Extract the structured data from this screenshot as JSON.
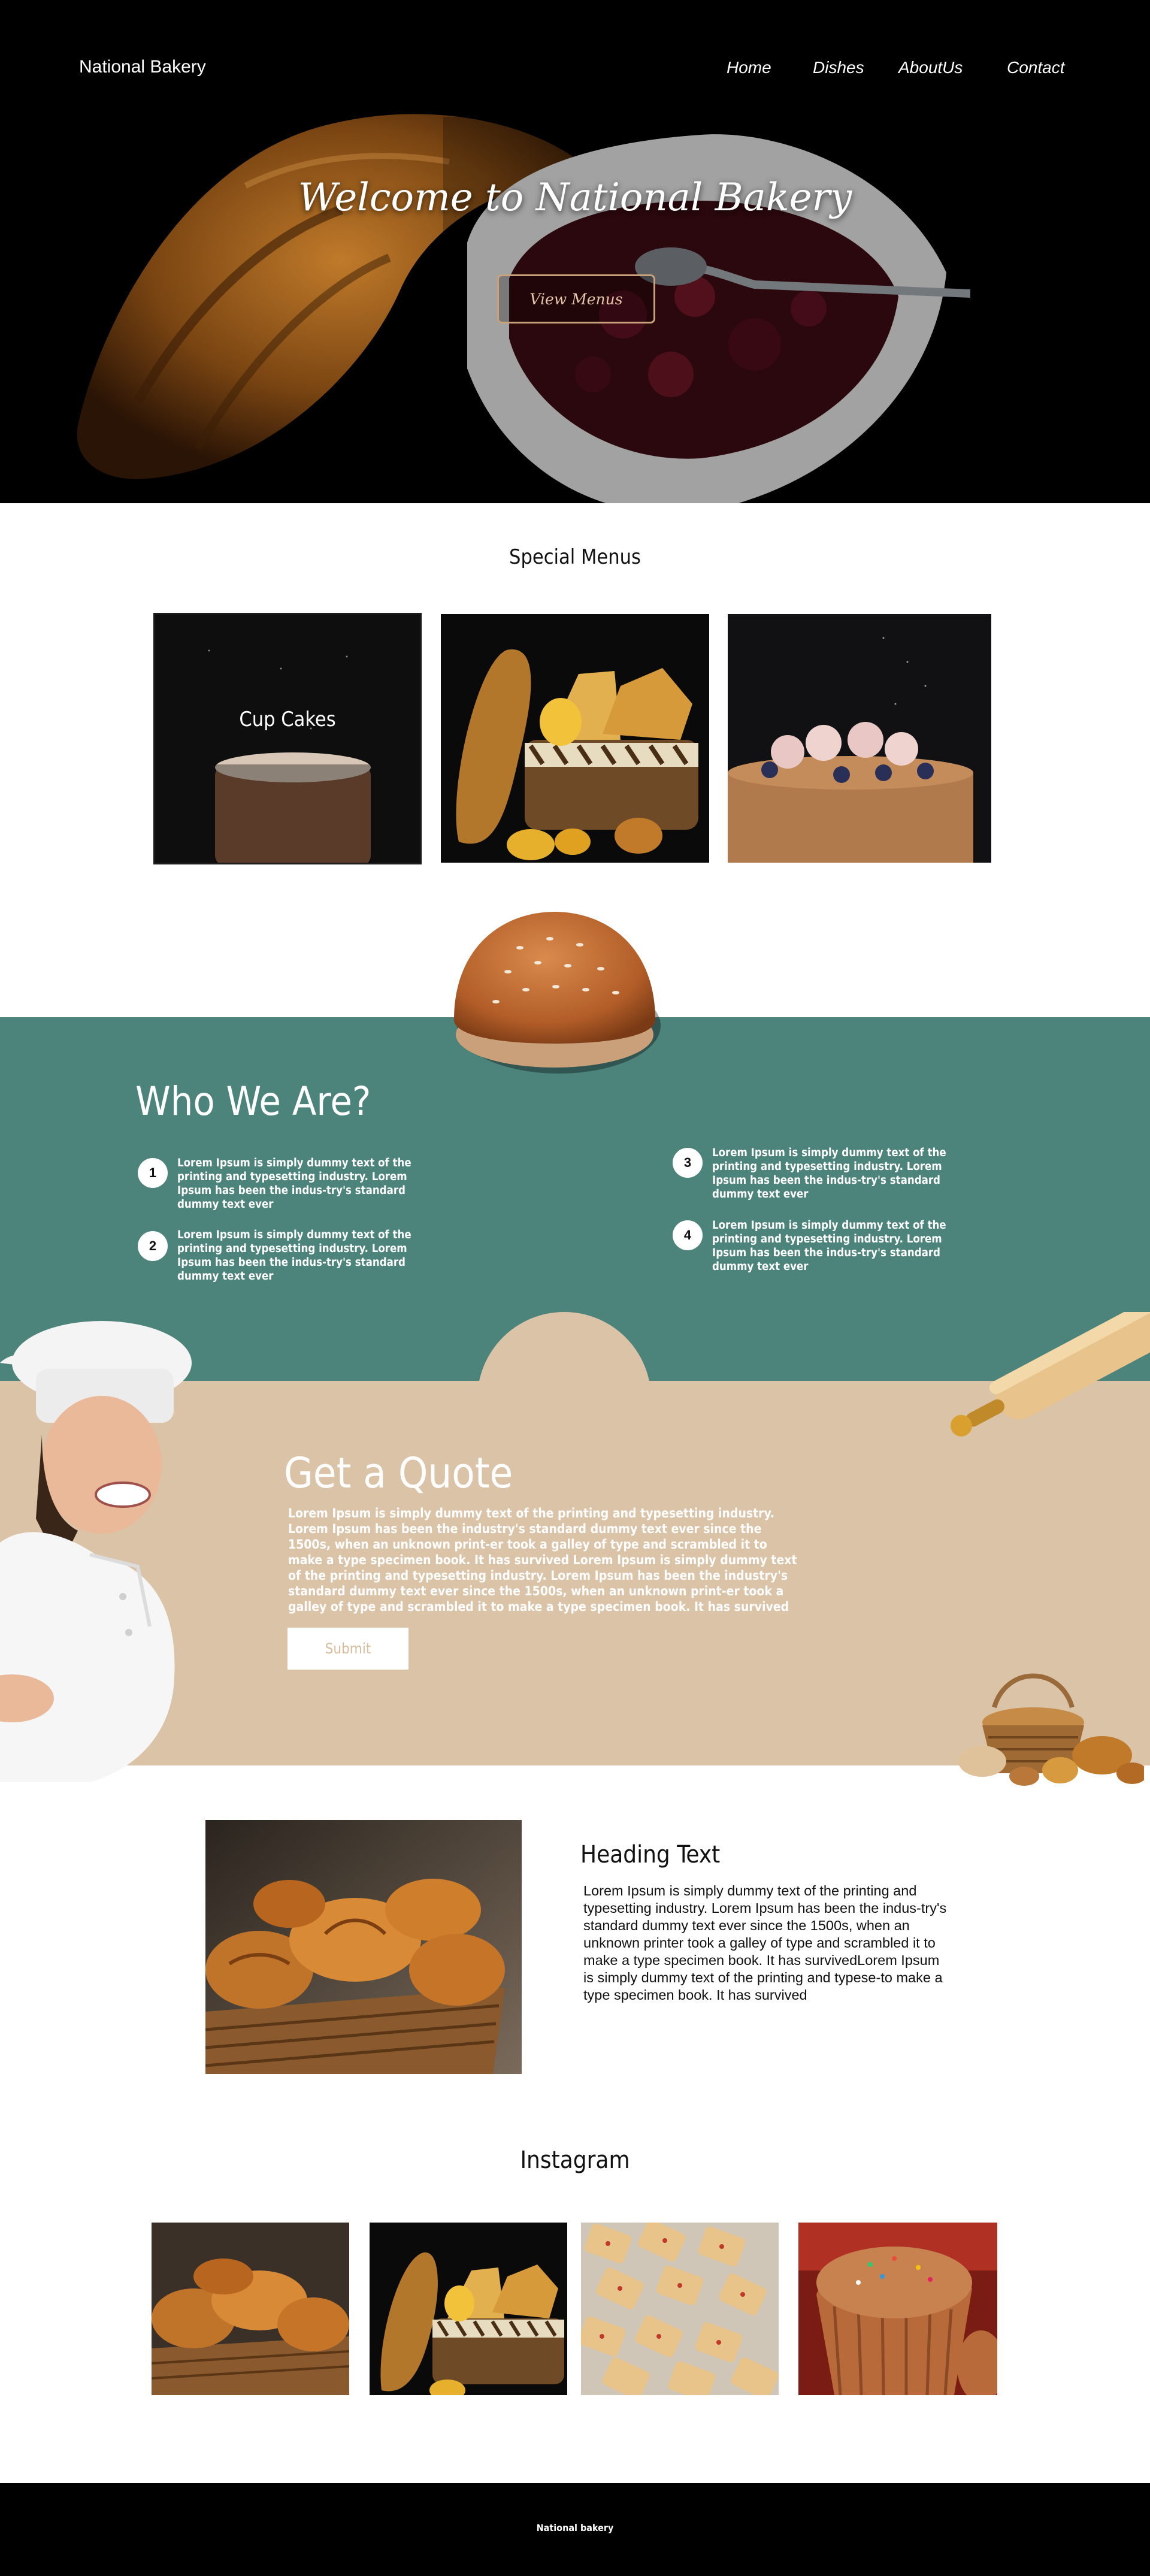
{
  "header": {
    "brand": "National Bakery",
    "nav": [
      "Home",
      "Dishes",
      "AboutUs",
      "Contact"
    ]
  },
  "hero": {
    "title": "Welcome to National Bakery",
    "button": "View Menus"
  },
  "special_menus": {
    "title": "Special Menus",
    "cards": [
      {
        "label": "Cup Cakes",
        "image": "cupcake-image"
      },
      {
        "image": "bread-basket-image"
      },
      {
        "image": "berry-cake-image"
      }
    ]
  },
  "who_we_are": {
    "title": "Who We Are?",
    "items": [
      {
        "num": "1",
        "text": "Lorem Ipsum is simply dummy text of the printing and typesetting industry. Lorem Ipsum has been the indus-try's standard dummy text ever"
      },
      {
        "num": "2",
        "text": "Lorem Ipsum is simply dummy text of the printing and typesetting industry. Lorem Ipsum has been the indus-try's standard dummy text ever"
      },
      {
        "num": "3",
        "text": "Lorem Ipsum is simply dummy text of the printing and typesetting industry. Lorem Ipsum has been the indus-try's standard dummy text ever"
      },
      {
        "num": "4",
        "text": "Lorem Ipsum is simply dummy text of the printing and typesetting industry. Lorem Ipsum has been the indus-try's standard dummy text ever"
      }
    ]
  },
  "quote": {
    "title": "Get a Quote",
    "body": "Lorem Ipsum is simply dummy text of the printing and typesetting industry. Lorem Ipsum has been the industry's standard dummy text ever since the 1500s, when an unknown print-er took a galley of type and scrambled it to make a type specimen book. It has survived Lorem Ipsum is simply dummy text of the printing and typesetting industry. Lorem Ipsum has been the industry's standard dummy text ever since the 1500s, when an unknown print-er took a galley of type and scrambled it to make a type specimen book. It has survived",
    "button": "Submit"
  },
  "feature": {
    "title": "Heading Text",
    "body": "Lorem Ipsum is simply dummy text of the printing and typesetting industry. Lorem Ipsum has been the indus-try's standard dummy text ever since the 1500s, when an unknown printer took a galley of type and scrambled it to make a type specimen book. It has survivedLorem Ipsum is simply dummy text of the printing and typese-to make a type specimen book. It has survived"
  },
  "instagram": {
    "title": "Instagram",
    "images": [
      "croissant-basket-image",
      "bread-basket-image",
      "cookies-image",
      "muffin-image"
    ]
  },
  "footer": {
    "text": "National bakery"
  },
  "colors": {
    "hero_bg": "#000000",
    "teal": "#4c837b",
    "beige": "#dac3a7",
    "accent_border": "#c9a27c",
    "footer_bg": "#000000"
  }
}
